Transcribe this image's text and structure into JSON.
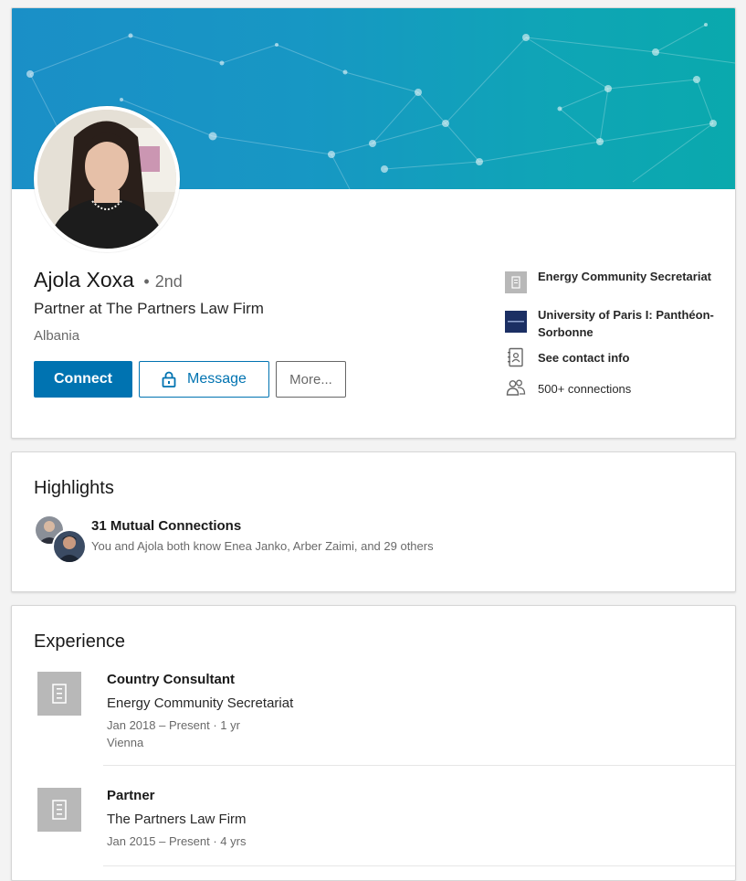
{
  "profile": {
    "name": "Ajola Xoxa",
    "degree_dot": "•",
    "degree": "2nd",
    "headline": "Partner at The Partners Law Firm",
    "location": "Albania",
    "actions": {
      "connect": "Connect",
      "message": "Message",
      "more": "More..."
    },
    "side": {
      "company": "Energy Community Secretariat",
      "school": "University of Paris I: Panthéon-Sorbonne",
      "contact": "See contact info",
      "connections": "500+ connections"
    }
  },
  "highlights": {
    "title": "Highlights",
    "mutual_title": "31 Mutual Connections",
    "mutual_sub": "You and Ajola both know Enea Janko, Arber Zaimi, and 29 others"
  },
  "experience": {
    "title": "Experience",
    "items": [
      {
        "title": "Country Consultant",
        "company": "Energy Community Secretariat",
        "dates": "Jan 2018 – Present · 1 yr",
        "location": "Vienna"
      },
      {
        "title": "Partner",
        "company": "The Partners Law Firm",
        "dates": "Jan 2015 – Present · 4 yrs",
        "location": ""
      }
    ]
  },
  "colors": {
    "primary": "#0073b1",
    "banner_start": "#1a8fc7",
    "banner_end": "#0aa9ad",
    "logo_placeholder": "#b8b8b8",
    "school_logo": "#1b2f63"
  }
}
